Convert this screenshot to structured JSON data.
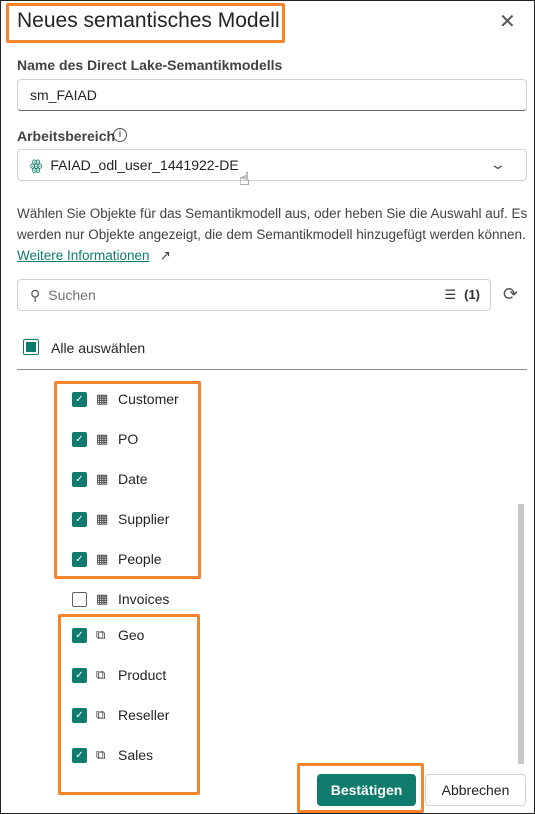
{
  "dialog": {
    "title": "Neues semantisches Modell",
    "close_icon": "close-icon"
  },
  "name_field": {
    "label": "Name des Direct Lake-Semantikmodells",
    "value": "sm_FAIAD"
  },
  "workspace": {
    "label": "Arbeitsbereich",
    "value": "FAIAD_odl_user_1441922-DE"
  },
  "description": {
    "text": "Wählen Sie Objekte für das Semantikmodell aus, oder heben Sie die Auswahl auf. Es werden nur Objekte angezeigt, die dem Semantikmodell hinzugefügt werden können. ",
    "link": "Weitere Informationen"
  },
  "search": {
    "placeholder": "Suchen",
    "filter_count": "(1)"
  },
  "select_all": {
    "label": "Alle auswählen",
    "state": "indeterminate"
  },
  "items": [
    {
      "label": "Customer",
      "type": "table",
      "checked": true
    },
    {
      "label": "PO",
      "type": "table",
      "checked": true
    },
    {
      "label": "Date",
      "type": "table",
      "checked": true
    },
    {
      "label": "Supplier",
      "type": "table",
      "checked": true
    },
    {
      "label": "People",
      "type": "table",
      "checked": true
    },
    {
      "label": "Invoices",
      "type": "table",
      "checked": false
    },
    {
      "label": "Geo",
      "type": "view",
      "checked": true
    },
    {
      "label": "Product",
      "type": "view",
      "checked": true
    },
    {
      "label": "Reseller",
      "type": "view",
      "checked": true
    },
    {
      "label": "Sales",
      "type": "view",
      "checked": true
    }
  ],
  "buttons": {
    "confirm": "Bestätigen",
    "cancel": "Abbrechen"
  },
  "colors": {
    "accent": "#0f7b6c",
    "highlight": "#f7832a"
  }
}
